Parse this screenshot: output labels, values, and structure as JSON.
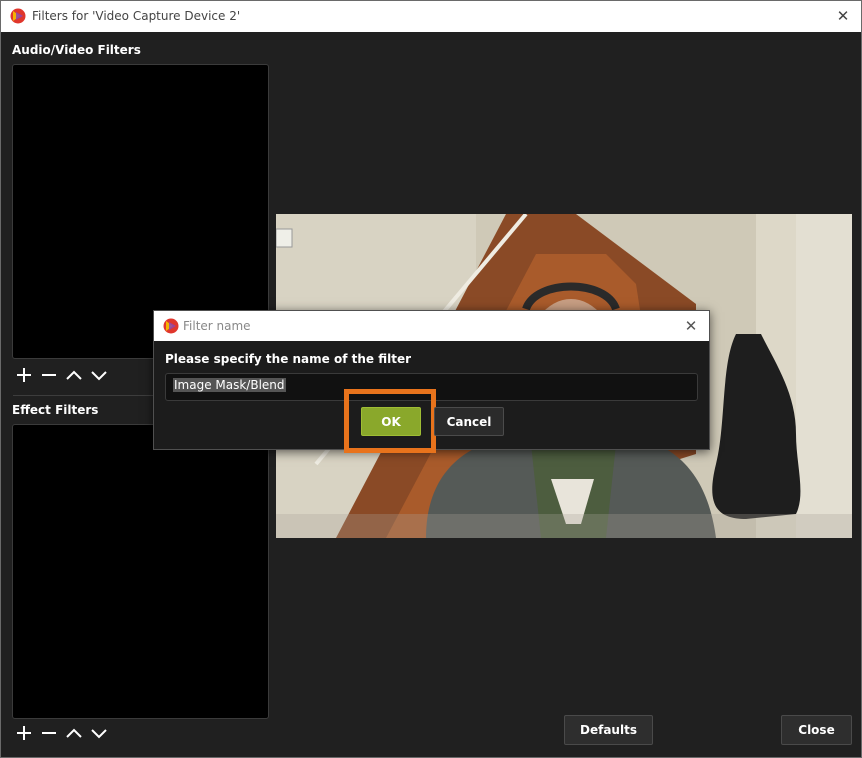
{
  "window": {
    "title": "Filters for 'Video Capture Device 2'",
    "close_glyph": "✕"
  },
  "audio_video": {
    "label": "Audio/Video Filters",
    "toolbar": [
      "add-icon",
      "remove-icon",
      "move-up-icon",
      "move-down-icon"
    ]
  },
  "effect": {
    "label": "Effect Filters",
    "toolbar": [
      "add-icon",
      "remove-icon",
      "move-up-icon",
      "move-down-icon"
    ]
  },
  "buttons": {
    "defaults": "Defaults",
    "close": "Close"
  },
  "dialog": {
    "title": "Filter name",
    "close_glyph": "✕",
    "prompt": "Please specify the name of the filter",
    "input_value": "Image Mask/Blend",
    "ok": "OK",
    "cancel": "Cancel"
  },
  "colors": {
    "accent_ok": "#8aa82b",
    "highlight": "#e8731c",
    "background": "#202020"
  }
}
